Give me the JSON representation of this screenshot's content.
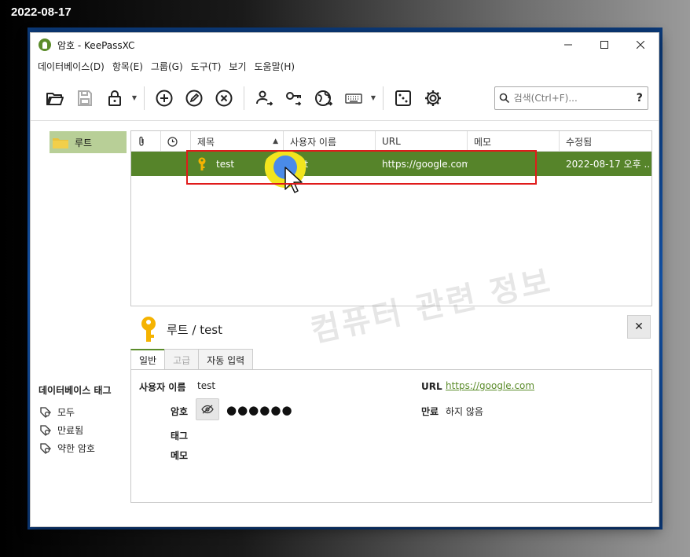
{
  "date_stamp": "2022-08-17",
  "window": {
    "title": "암호 - KeePassXC"
  },
  "menu": [
    "데이터베이스(D)",
    "항목(E)",
    "그룹(G)",
    "도구(T)",
    "보기",
    "도움말(H)"
  ],
  "search": {
    "placeholder": "검색(Ctrl+F)...",
    "help": "?"
  },
  "groups": [
    {
      "label": "루트"
    }
  ],
  "table": {
    "headers": [
      "",
      "",
      "제목",
      "사용자 이름",
      "URL",
      "메모",
      "수정됨"
    ],
    "rows": [
      {
        "title": "test",
        "username": "test",
        "url": "https://google.com",
        "notes": "",
        "modified": "2022-08-17 오후 ..."
      }
    ]
  },
  "watermark": "컴퓨터 관련 정보",
  "detail": {
    "title": "루트 / test",
    "tabs": [
      "일반",
      "고급",
      "자동 입력"
    ],
    "fields": {
      "username_label": "사용자 이름",
      "username_value": "test",
      "password_label": "암호",
      "password_value": "●●●●●●",
      "tags_label": "태그",
      "notes_label": "메모",
      "url_label": "URL",
      "url_value": "https://google.com",
      "expiry_label": "만료",
      "expiry_value": "하지 않음"
    }
  },
  "tags": {
    "title": "데이터베이스 태그",
    "items": [
      "모두",
      "만료됨",
      "약한 암호"
    ]
  },
  "colors": {
    "accent": "#5b8c2a",
    "selected_row": "#56842a",
    "group_selected": "#b8cf97",
    "highlight": "#e01b1b"
  }
}
